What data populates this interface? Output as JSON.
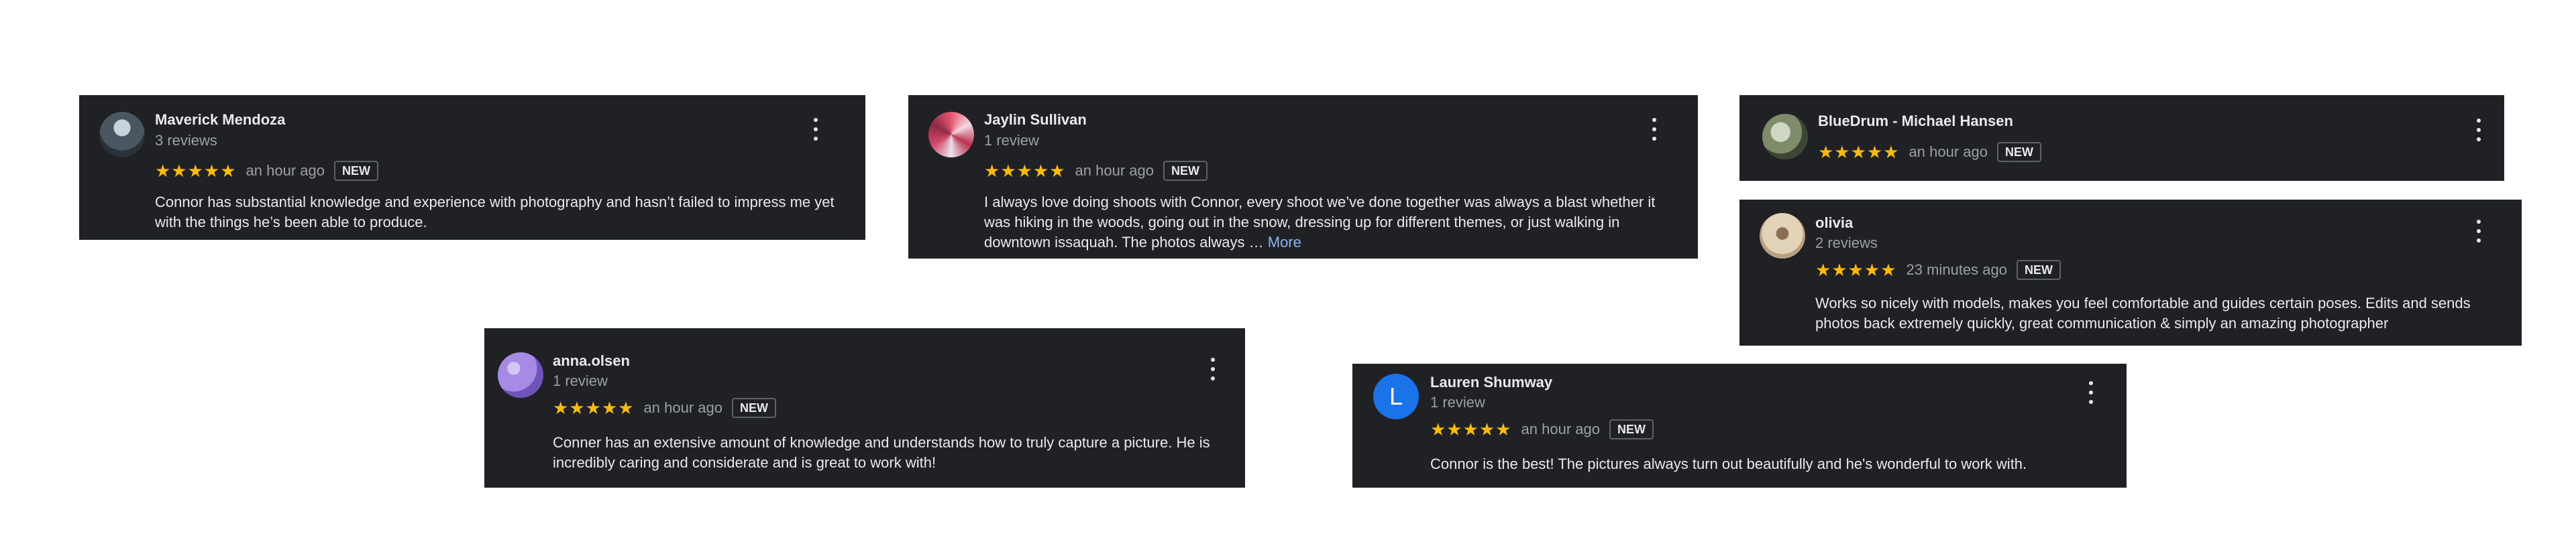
{
  "reviews": [
    {
      "name": "Maverick Mendoza",
      "sub": "3 reviews",
      "stars": "★★★★★",
      "time": "an hour ago",
      "badge": "NEW",
      "text": "Connor has substantial knowledge and experience with photography and hasn’t failed to impress me yet with the things he’s been able to produce.",
      "avatar_color": "#6b7785"
    },
    {
      "name": "Jaylin Sullivan",
      "sub": "1 review",
      "stars": "★★★★★",
      "time": "an hour ago",
      "badge": "NEW",
      "text": "I always love doing shoots with Connor, every shoot we’ve done together was always a blast whether it was hiking in the woods, going out in the snow, dressing up for different themes, or just walking in downtown issaquah. The photos always …",
      "more": "More",
      "avatar_color": "#c0396b"
    },
    {
      "name": "BlueDrum - Michael Hansen",
      "sub": "",
      "stars": "★★★★★",
      "time": "an hour ago",
      "badge": "NEW",
      "text": "",
      "avatar_color": "#7a8a6a"
    },
    {
      "name": "olivia",
      "sub": "2 reviews",
      "stars": "★★★★★",
      "time": "23 minutes ago",
      "badge": "NEW",
      "text": "Works so nicely with models, makes you feel comfortable and guides certain poses. Edits and sends photos back extremely quickly, great communication & simply an amazing photographer",
      "avatar_color": "#c9b08a"
    },
    {
      "name": "anna.olsen",
      "sub": "1 review",
      "stars": "★★★★★",
      "time": "an hour ago",
      "badge": "NEW",
      "text": "Conner has an extensive amount of knowledge and understands how to truly capture a picture. He is incredibly caring and considerate and is great to work with!",
      "avatar_color": "#9a7fd8"
    },
    {
      "name": "Lauren Shumway",
      "sub": "1 review",
      "stars": "★★★★★",
      "time": "an hour ago",
      "badge": "NEW",
      "text": "Connor is the best! The pictures always turn out beautifully and he's wonderful to work with.",
      "avatar_letter": "L",
      "avatar_color": "#1a73e8"
    }
  ]
}
